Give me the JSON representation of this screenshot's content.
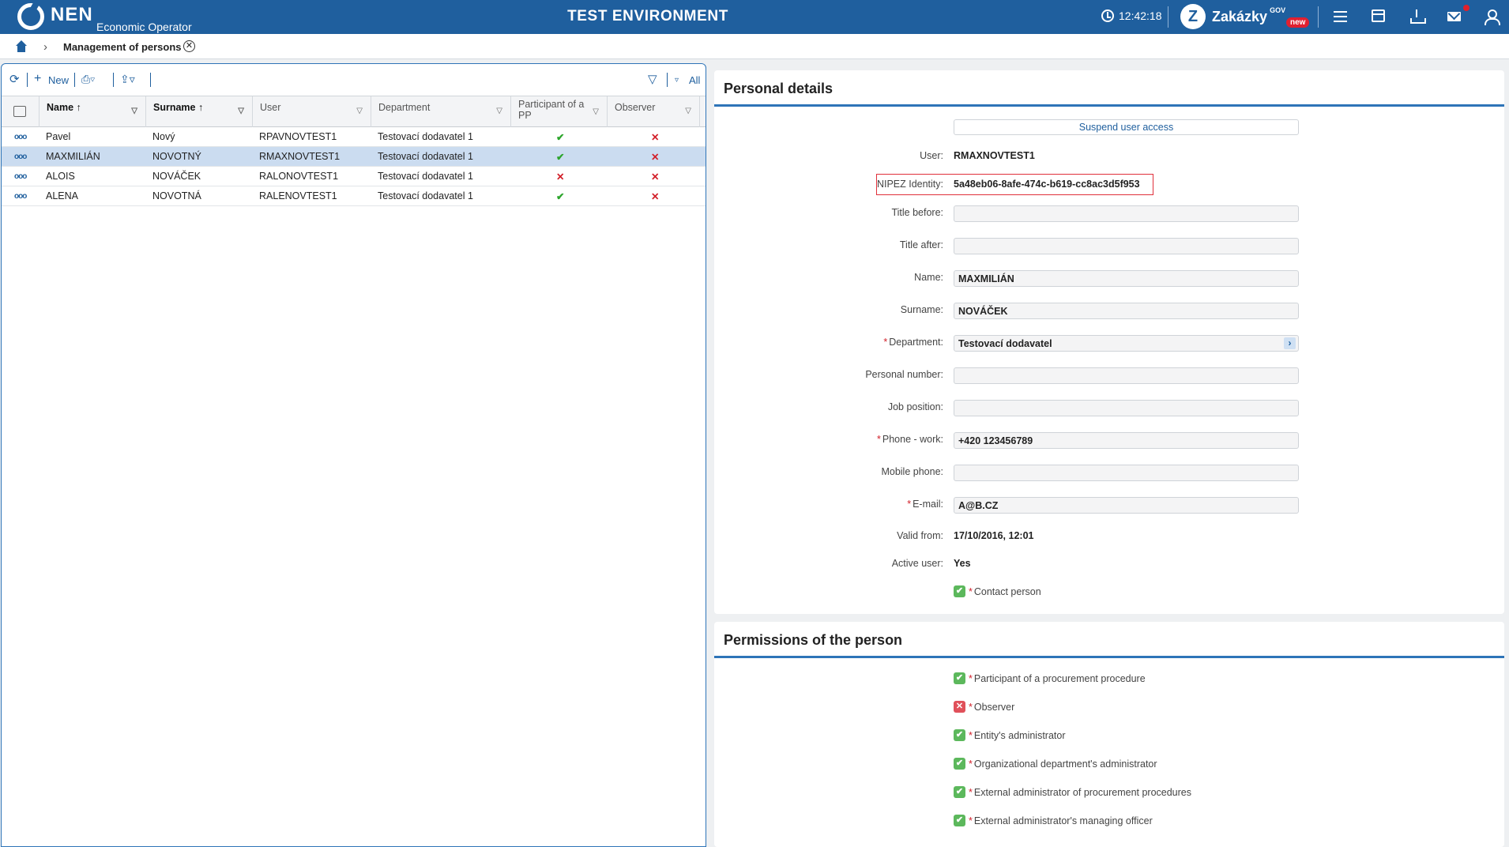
{
  "header": {
    "logo_name": "NEN",
    "logo_sub": "Economic Operator",
    "environment": "TEST ENVIRONMENT",
    "time": "12:42:18",
    "zakazky_name": "Zakázky",
    "zakazky_gov": "GOV",
    "zakazky_badge": "new",
    "accent_color": "#1f5f9e"
  },
  "breadcrumb": {
    "label": "Management of persons"
  },
  "toolbar": {
    "new_label": "New",
    "filter_all": "All"
  },
  "table": {
    "columns": [
      "Name",
      "Surname",
      "User",
      "Department",
      "Participant of a PP",
      "Observer"
    ],
    "rows": [
      {
        "name": "Pavel",
        "surname": "Nový",
        "user": "RPAVNOVTEST1",
        "department": "Testovací dodavatel 1",
        "participant": "✔",
        "observer": "✕"
      },
      {
        "name": "MAXMILIÁN",
        "surname": "NOVOTNÝ",
        "user": "RMAXNOVTEST1",
        "department": "Testovací dodavatel 1",
        "participant": "✔",
        "observer": "✕"
      },
      {
        "name": "ALOIS",
        "surname": "NOVÁČEK",
        "user": "RALONOVTEST1",
        "department": "Testovací dodavatel 1",
        "participant": "✕",
        "observer": "✕"
      },
      {
        "name": "ALENA",
        "surname": "NOVOTNÁ",
        "user": "RALENOVTEST1",
        "department": "Testovací dodavatel 1",
        "participant": "✔",
        "observer": "✕"
      }
    ]
  },
  "details": {
    "title": "Personal details",
    "suspend_button": "Suspend user access",
    "user_label": "User:",
    "user_value": "RMAXNOVTEST1",
    "nipez_label": "NIPEZ Identity:",
    "nipez_value": "5a48eb06-8afe-474c-b619-cc8ac3d5f953",
    "title_before_label": "Title before:",
    "title_before_value": "",
    "title_after_label": "Title after:",
    "title_after_value": "",
    "name_label": "Name:",
    "name_value": "MAXMILIÁN",
    "surname_label": "Surname:",
    "surname_value": "NOVÁČEK",
    "department_label": "Department:",
    "department_value": "Testovací dodavatel",
    "personal_number_label": "Personal number:",
    "personal_number_value": "",
    "job_position_label": "Job position:",
    "job_position_value": "",
    "phone_work_label": "Phone - work:",
    "phone_work_value": "+420 123456789",
    "mobile_phone_label": "Mobile phone:",
    "mobile_phone_value": "",
    "email_label": "E-mail:",
    "email_value": "A@B.CZ",
    "valid_from_label": "Valid from:",
    "valid_from_value": "17/10/2016, 12:01",
    "active_user_label": "Active user:",
    "active_user_value": "Yes",
    "contact_person_label": "Contact person",
    "required_mark": "*"
  },
  "permissions": {
    "title": "Permissions of the person",
    "items": [
      {
        "label": "Participant of a procurement procedure",
        "checked": true,
        "mark": "✔"
      },
      {
        "label": "Observer",
        "checked": false,
        "mark": "✕"
      },
      {
        "label": "Entity's administrator",
        "checked": true,
        "mark": "✔"
      },
      {
        "label": "Organizational department's administrator",
        "checked": true,
        "mark": "✔"
      },
      {
        "label": "External administrator of procurement procedures",
        "checked": true,
        "mark": "✔"
      },
      {
        "label": "External administrator's managing officer",
        "checked": true,
        "mark": "✔"
      }
    ]
  }
}
